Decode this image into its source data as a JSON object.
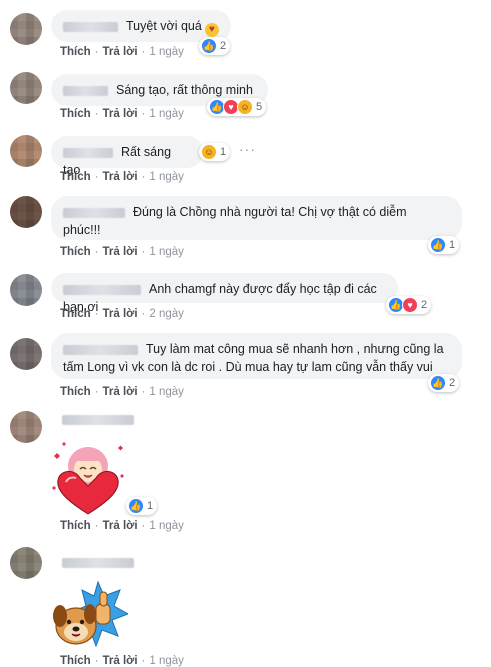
{
  "actions": {
    "like": "Thích",
    "reply": "Trả lời",
    "separator": "·"
  },
  "comments": [
    {
      "text": "Tuyệt vời quá",
      "time": "1 ngày",
      "reaction_count": "2"
    },
    {
      "text": "Sáng tạo, rất thông minh",
      "time": "1 ngày",
      "reaction_count": "5"
    },
    {
      "text": "Rất sáng tạo",
      "time": "1 ngày",
      "reaction_count": "1"
    },
    {
      "text_line1": "Đúng là Chồng nhà người ta! Chị vợ thật có diễm",
      "text_line2": "phúc!!!",
      "time": "1 ngày",
      "reaction_count": "1"
    },
    {
      "text": "Anh chamgf này được đẩy học tập đi các bạn ơi",
      "time": "2 ngày",
      "reaction_count": "2"
    },
    {
      "text_line1": "Tuy làm mat công mua sẽ nhanh hơn , nhưng cũng la",
      "text_line2": "tấm Long vì vk con là dc roi . Dù mua hay tự lam cũng vẫn thấy vui",
      "time": "1 ngày",
      "reaction_count": "2"
    },
    {
      "sticker": "heart-girl-sticker",
      "time": "1 ngày",
      "reaction_count": "1"
    },
    {
      "sticker": "dog-thumbs-up-sticker",
      "time": "1 ngày"
    }
  ],
  "colors": {
    "like": "#2d87ff",
    "love": "#f33e58",
    "haha": "#f7b125",
    "bubble": "#f2f3f5"
  }
}
